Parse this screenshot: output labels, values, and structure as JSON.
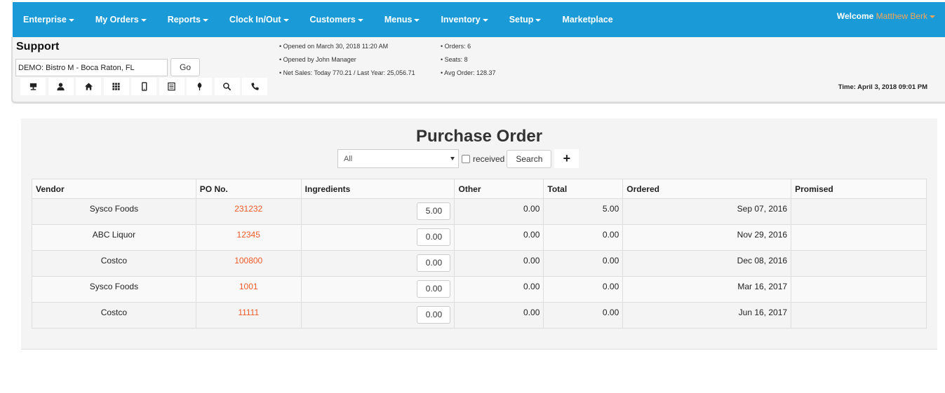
{
  "nav": {
    "items": [
      {
        "label": "Enterprise",
        "dropdown": true
      },
      {
        "label": "My Orders",
        "dropdown": true
      },
      {
        "label": "Reports",
        "dropdown": true
      },
      {
        "label": "Clock In/Out",
        "dropdown": true
      },
      {
        "label": "Customers",
        "dropdown": true
      },
      {
        "label": "Menus",
        "dropdown": true
      },
      {
        "label": "Inventory",
        "dropdown": true
      },
      {
        "label": "Setup",
        "dropdown": true
      },
      {
        "label": "Marketplace",
        "dropdown": false
      }
    ],
    "welcome_label": "Welcome",
    "user_name": "Matthew Berk"
  },
  "header": {
    "title": "Support",
    "store_value": "DEMO: Bistro M - Boca Raton, FL",
    "go_label": "Go",
    "icons": [
      "register-icon",
      "user-icon",
      "home-icon",
      "grid-icon",
      "mobile-icon",
      "list-icon",
      "tree-icon",
      "search-icon",
      "phone-icon"
    ],
    "info_left": [
      "• Opened on March 30, 2018 11:20 AM",
      "• Opened by John Manager",
      "• Net Sales: Today 770.21 / Last Year: 25,056.71"
    ],
    "info_right": [
      "• Orders: 6",
      "• Seats: 8",
      "• Avg Order: 128.37"
    ],
    "time": "Time: April 3, 2018 09:01 PM"
  },
  "purchase_order": {
    "title": "Purchase Order",
    "filter_value": "All",
    "received_label": "received",
    "search_label": "Search",
    "add_label": "+",
    "columns": [
      "Vendor",
      "PO No.",
      "Ingredients",
      "Other",
      "Total",
      "Ordered",
      "Promised"
    ],
    "rows": [
      {
        "vendor": "Sysco Foods",
        "po": "231232",
        "ingredients": "5.00",
        "other": "0.00",
        "total": "5.00",
        "ordered": "Sep 07, 2016",
        "promised": ""
      },
      {
        "vendor": "ABC Liquor",
        "po": "12345",
        "ingredients": "0.00",
        "other": "0.00",
        "total": "0.00",
        "ordered": "Nov 29, 2016",
        "promised": ""
      },
      {
        "vendor": "Costco",
        "po": "100800",
        "ingredients": "0.00",
        "other": "0.00",
        "total": "0.00",
        "ordered": "Dec 08, 2016",
        "promised": ""
      },
      {
        "vendor": "Sysco Foods",
        "po": "1001",
        "ingredients": "0.00",
        "other": "0.00",
        "total": "0.00",
        "ordered": "Mar 16, 2017",
        "promised": ""
      },
      {
        "vendor": "Costco",
        "po": "11111",
        "ingredients": "0.00",
        "other": "0.00",
        "total": "0.00",
        "ordered": "Jun 16, 2017",
        "promised": ""
      }
    ]
  },
  "colors": {
    "nav_bg": "#1a9bd7",
    "user_accent": "#f2a65a",
    "po_link": "#f05a28"
  }
}
